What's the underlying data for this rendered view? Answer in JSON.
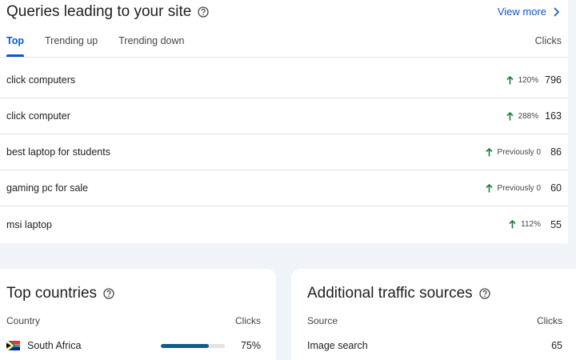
{
  "queries": {
    "title": "Queries leading to your site",
    "view_more": "View more",
    "tabs": [
      {
        "label": "Top",
        "active": true
      },
      {
        "label": "Trending up",
        "active": false
      },
      {
        "label": "Trending down",
        "active": false
      }
    ],
    "clicks_header": "Clicks",
    "rows": [
      {
        "query": "click computers",
        "change": "120%",
        "clicks": "796"
      },
      {
        "query": "click computer",
        "change": "288%",
        "clicks": "163"
      },
      {
        "query": "best laptop for students",
        "change": "Previously 0",
        "clicks": "86"
      },
      {
        "query": "gaming pc for sale",
        "change": "Previously 0",
        "clicks": "60"
      },
      {
        "query": "msi laptop",
        "change": "112%",
        "clicks": "55"
      }
    ]
  },
  "countries": {
    "title": "Top countries",
    "col_country": "Country",
    "col_clicks": "Clicks",
    "items": [
      {
        "name": "South Africa",
        "percent": "75%",
        "share": 0.75
      }
    ]
  },
  "traffic": {
    "title": "Additional traffic sources",
    "col_source": "Source",
    "col_clicks": "Clicks",
    "items": [
      {
        "source": "Image search",
        "clicks": "65"
      }
    ]
  },
  "colors": {
    "accent": "#0b57d0",
    "trend_up": "#188038",
    "bar_fill": "#0f5e87",
    "background": "#f0f4f9"
  },
  "icons": {
    "help": "help-circle-icon",
    "chevron": "chevron-right-icon",
    "trend": "arrow-up-icon",
    "flag": "south-africa-flag-icon"
  }
}
